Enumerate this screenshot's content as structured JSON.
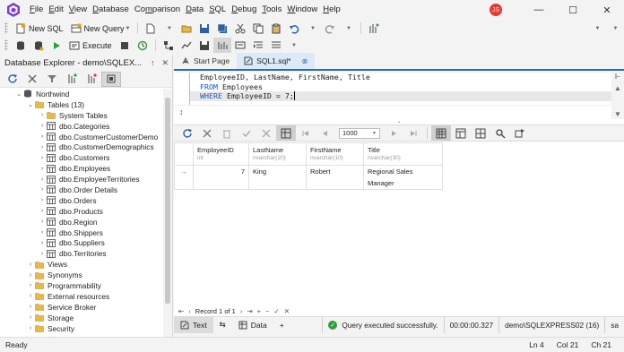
{
  "menu": [
    "File",
    "Edit",
    "View",
    "Database",
    "Comparison",
    "Data",
    "SQL",
    "Debug",
    "Tools",
    "Window",
    "Help"
  ],
  "menu_mnemonics": [
    "F",
    "E",
    "V",
    "D",
    "m",
    "D",
    "S",
    "D",
    "T",
    "W",
    "H"
  ],
  "user_initials": "JS",
  "toolbar1": {
    "new_sql": "New SQL",
    "new_query": "New Query"
  },
  "toolbar2": {
    "execute": "Execute"
  },
  "explorer": {
    "title": "Database Explorer - demo\\SQLEX...",
    "pin": "↑",
    "close": "✕",
    "tree": [
      {
        "level": 0,
        "exp": "⌄",
        "icon": "db",
        "label": "Northwind"
      },
      {
        "level": 1,
        "exp": "⌄",
        "icon": "folder",
        "label": "Tables (13)"
      },
      {
        "level": 2,
        "exp": "›",
        "icon": "folder",
        "label": "System Tables"
      },
      {
        "level": 2,
        "exp": "›",
        "icon": "table",
        "label": "dbo.Categories"
      },
      {
        "level": 2,
        "exp": "›",
        "icon": "table",
        "label": "dbo.CustomerCustomerDemo"
      },
      {
        "level": 2,
        "exp": "›",
        "icon": "table",
        "label": "dbo.CustomerDemographics"
      },
      {
        "level": 2,
        "exp": "›",
        "icon": "table",
        "label": "dbo.Customers"
      },
      {
        "level": 2,
        "exp": "›",
        "icon": "table",
        "label": "dbo.Employees"
      },
      {
        "level": 2,
        "exp": "›",
        "icon": "table",
        "label": "dbo.EmployeeTerritories"
      },
      {
        "level": 2,
        "exp": "›",
        "icon": "table",
        "label": "dbo.Order Details"
      },
      {
        "level": 2,
        "exp": "›",
        "icon": "table",
        "label": "dbo.Orders"
      },
      {
        "level": 2,
        "exp": "›",
        "icon": "table",
        "label": "dbo.Products"
      },
      {
        "level": 2,
        "exp": "›",
        "icon": "table",
        "label": "dbo.Region"
      },
      {
        "level": 2,
        "exp": "›",
        "icon": "table",
        "label": "dbo.Shippers"
      },
      {
        "level": 2,
        "exp": "›",
        "icon": "table",
        "label": "dbo.Suppliers"
      },
      {
        "level": 2,
        "exp": "›",
        "icon": "table",
        "label": "dbo.Territories"
      },
      {
        "level": 1,
        "exp": "›",
        "icon": "folder",
        "label": "Views"
      },
      {
        "level": 1,
        "exp": "›",
        "icon": "folder",
        "label": "Synonyms"
      },
      {
        "level": 1,
        "exp": "›",
        "icon": "folder",
        "label": "Programmability"
      },
      {
        "level": 1,
        "exp": "›",
        "icon": "folder",
        "label": "External resources"
      },
      {
        "level": 1,
        "exp": "›",
        "icon": "folder",
        "label": "Service Broker"
      },
      {
        "level": 1,
        "exp": "›",
        "icon": "folder",
        "label": "Storage"
      },
      {
        "level": 1,
        "exp": "›",
        "icon": "folder",
        "label": "Security"
      }
    ]
  },
  "tabs": {
    "start_page": "Start Page",
    "sql1": "SQL1.sql*",
    "close": "⊗"
  },
  "editor": {
    "line1": "EmployeeID, LastName, FirstName, Title",
    "line2_kw": "FROM",
    "line2_rest": " Employees",
    "line3_kw": "WHERE",
    "line3_rest": " EmployeeID = 7;"
  },
  "grid": {
    "page_size": "1000",
    "columns": [
      {
        "name": "EmployeeID",
        "type": "int"
      },
      {
        "name": "LastName",
        "type": "nvarchar(20)"
      },
      {
        "name": "FirstName",
        "type": "nvarchar(10)"
      },
      {
        "name": "Title",
        "type": "nvarchar(30)"
      }
    ],
    "rows": [
      {
        "indicator": "→",
        "cells": [
          "7",
          "King",
          "Robert",
          "Regional Sales Manager"
        ]
      }
    ]
  },
  "record_nav": {
    "first": "⇤",
    "prev": "‹",
    "text": "Record 1 of 1",
    "next": "›",
    "last": "⇥",
    "add": "+",
    "remove": "−",
    "accept": "✓",
    "cancel": "✕"
  },
  "result_bar": {
    "text_tab": "Text",
    "data_tab": "Data",
    "add": "+",
    "status": "Query executed successfully.",
    "duration": "00:00:00.327",
    "connection": "demo\\SQLEXPRESS02 (16)",
    "user": "sa"
  },
  "status": {
    "left": "Ready",
    "ln": "Ln 4",
    "col": "Col 21",
    "ch": "Ch 21"
  },
  "colors": {
    "accent": "#2b6cb0",
    "keyword": "#1a56c4",
    "success": "#2e9e3e",
    "avatar": "#e53935"
  }
}
